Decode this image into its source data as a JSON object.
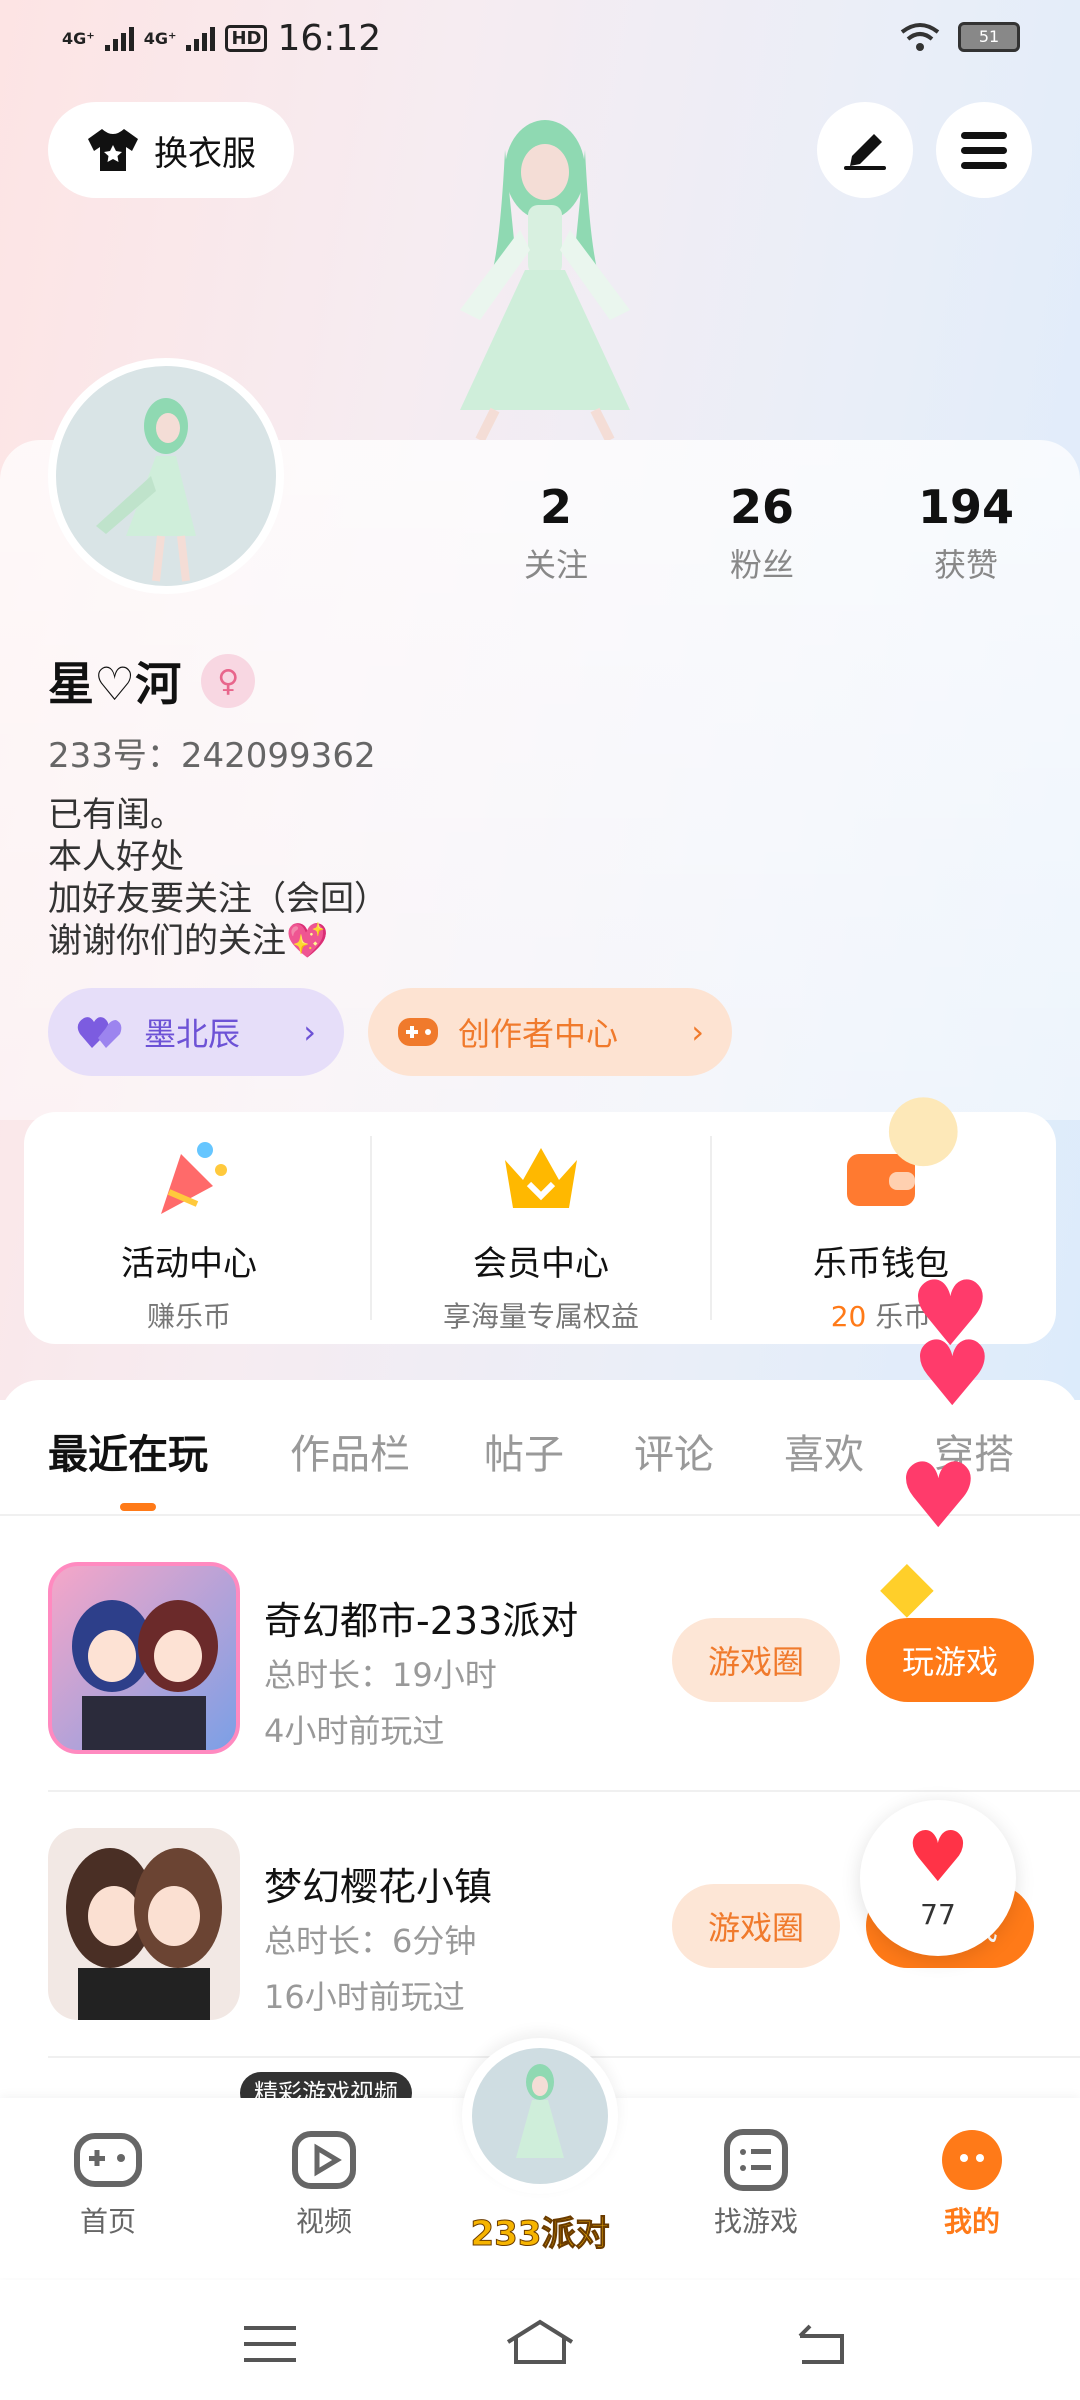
{
  "status_bar": {
    "time": "16:12",
    "network1": "4G⁺",
    "network2": "4G⁺",
    "hd": "HD",
    "battery": "51"
  },
  "top": {
    "outfit_label": "换衣服",
    "edit_icon": "pen-icon",
    "menu_icon": "menu-icon"
  },
  "profile": {
    "following_count": "2",
    "following_label": "关注",
    "fans_count": "26",
    "fans_label": "粉丝",
    "likes_count": "194",
    "likes_label": "获赞",
    "name": "星♡河",
    "gender_icon": "female-icon",
    "uid": "233号：242099362",
    "bio_lines": [
      "已有闺。",
      "本人好处",
      "加好友要关注（会回）",
      "谢谢你们的关注💖"
    ],
    "friend_pill": "墨北辰",
    "creator_pill": "创作者中心"
  },
  "centers": [
    {
      "title": "活动中心",
      "sub": "赚乐币",
      "icon": "party-popper-icon"
    },
    {
      "title": "会员中心",
      "sub": "享海量专属权益",
      "icon": "crown-icon"
    },
    {
      "title": "乐币钱包",
      "sub_value": "20",
      "sub_unit": "乐币",
      "icon": "wallet-icon"
    }
  ],
  "tabs": [
    "最近在玩",
    "作品栏",
    "帖子",
    "评论",
    "喜欢",
    "穿搭"
  ],
  "games": [
    {
      "title": "奇幻都市-233派对",
      "time": "总时长：19小时",
      "last": "4小时前玩过",
      "circle": "游戏圈",
      "play": "玩游戏"
    },
    {
      "title": "梦幻樱花小镇",
      "time": "总时长：6分钟",
      "last": "16小时前玩过",
      "circle": "游戏圈",
      "play": "玩游戏"
    }
  ],
  "like_float": {
    "count": "77"
  },
  "tooltip": "精彩游戏视频",
  "bottom_nav": [
    {
      "label": "首页",
      "icon": "gamepad-icon"
    },
    {
      "label": "视频",
      "icon": "video-play-icon"
    },
    {
      "label": "233派对",
      "icon": "avatar-party"
    },
    {
      "label": "找游戏",
      "icon": "list-icon"
    },
    {
      "label": "我的",
      "icon": "me-icon"
    }
  ],
  "colors": {
    "accent": "#ff7a18",
    "purple": "#6d52d6",
    "heart": "#ff3b6b"
  }
}
